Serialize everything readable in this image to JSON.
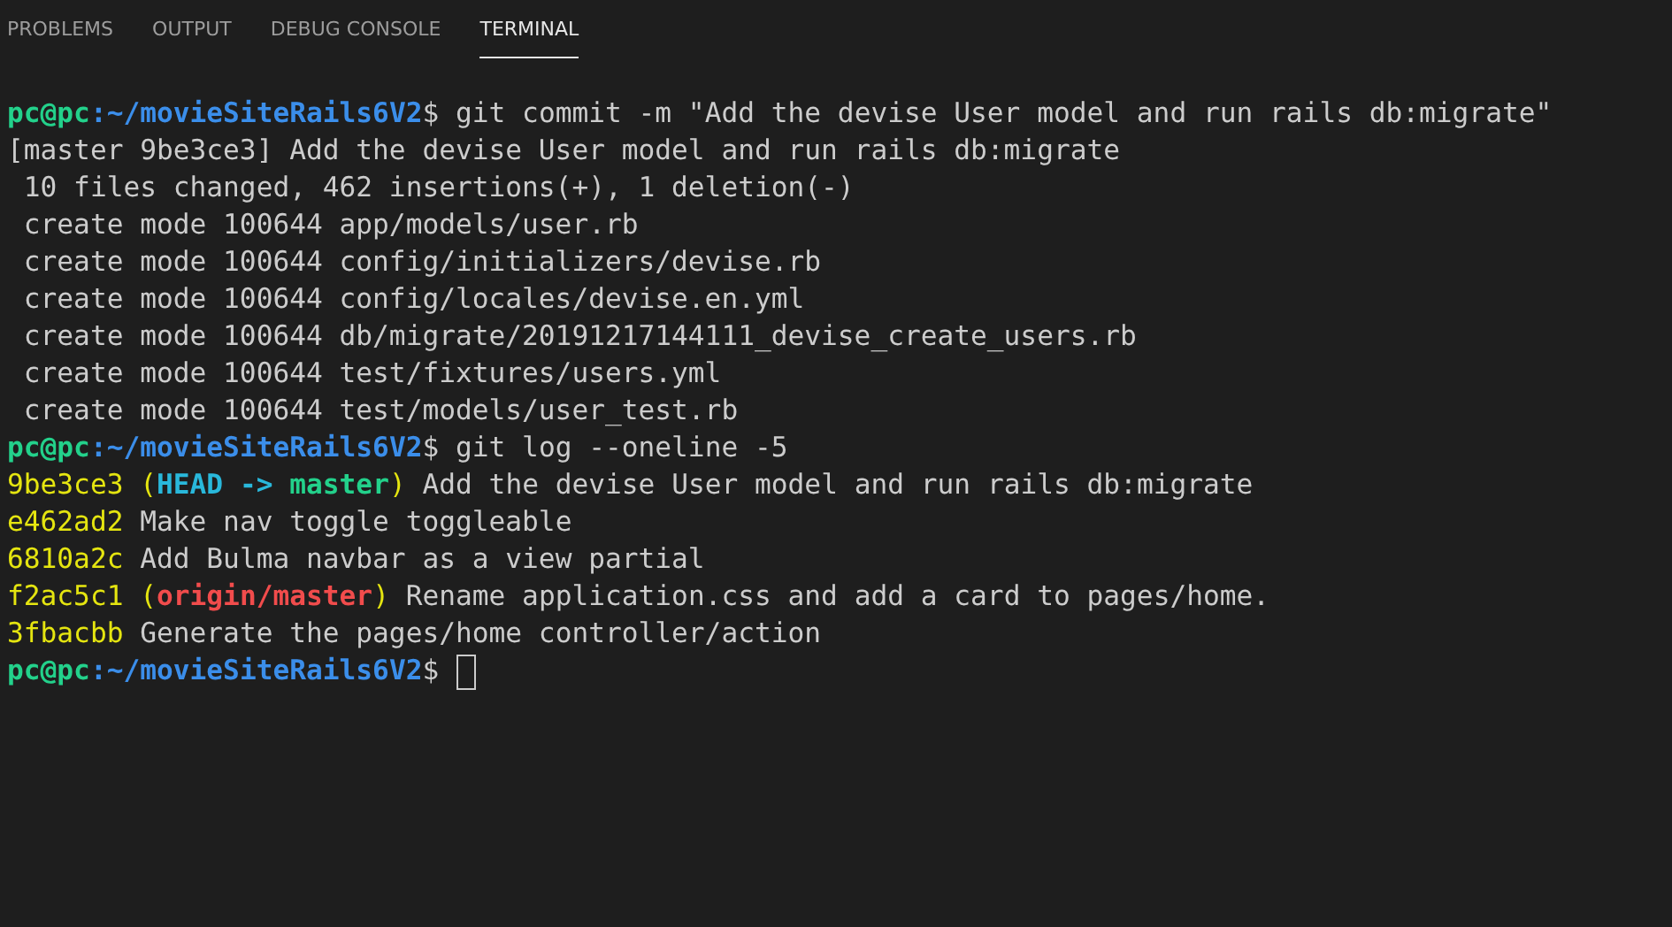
{
  "tabs": [
    {
      "label": "PROBLEMS",
      "selected": false
    },
    {
      "label": "OUTPUT",
      "selected": false
    },
    {
      "label": "DEBUG CONSOLE",
      "selected": false
    },
    {
      "label": "TERMINAL",
      "selected": true
    }
  ],
  "terminal": {
    "lines": [
      {
        "kind": "prompt",
        "user": "pc@pc",
        "path": ":~/movieSiteRails6V2",
        "symbol": "$",
        "command": "git commit -m \"Add the devise User model and run rails db:migrate\""
      },
      {
        "kind": "output",
        "text": "[master 9be3ce3] Add the devise User model and run rails db:migrate"
      },
      {
        "kind": "output",
        "text": " 10 files changed, 462 insertions(+), 1 deletion(-)"
      },
      {
        "kind": "output",
        "text": " create mode 100644 app/models/user.rb"
      },
      {
        "kind": "output",
        "text": " create mode 100644 config/initializers/devise.rb"
      },
      {
        "kind": "output",
        "text": " create mode 100644 config/locales/devise.en.yml"
      },
      {
        "kind": "output",
        "text": " create mode 100644 db/migrate/20191217144111_devise_create_users.rb"
      },
      {
        "kind": "output",
        "text": " create mode 100644 test/fixtures/users.yml"
      },
      {
        "kind": "output",
        "text": " create mode 100644 test/models/user_test.rb"
      },
      {
        "kind": "prompt",
        "user": "pc@pc",
        "path": ":~/movieSiteRails6V2",
        "symbol": "$",
        "command": "git log --oneline -5"
      },
      {
        "kind": "commit",
        "hash": "9be3ce3",
        "refs": [
          {
            "kind": "paren",
            "text": "("
          },
          {
            "kind": "head",
            "text": "HEAD"
          },
          {
            "kind": "head",
            "text": "->"
          },
          {
            "kind": "branch",
            "text": "master"
          },
          {
            "kind": "paren",
            "text": ")"
          }
        ],
        "message": "Add the devise User model and run rails db:migrate"
      },
      {
        "kind": "commit",
        "hash": "e462ad2",
        "message": "Make nav toggle toggleable"
      },
      {
        "kind": "commit",
        "hash": "6810a2c",
        "message": "Add Bulma navbar as a view partial"
      },
      {
        "kind": "commit",
        "hash": "f2ac5c1",
        "refs": [
          {
            "kind": "paren",
            "text": "("
          },
          {
            "kind": "remote",
            "text": "origin/master"
          },
          {
            "kind": "paren",
            "text": ")"
          }
        ],
        "message": "Rename application.css and add a card to pages/home."
      },
      {
        "kind": "commit",
        "hash": "3fbacbb",
        "message": "Generate the pages/home controller/action"
      },
      {
        "kind": "prompt",
        "user": "pc@pc",
        "path": ":~/movieSiteRails6V2",
        "symbol": "$",
        "cursor": true
      }
    ]
  }
}
